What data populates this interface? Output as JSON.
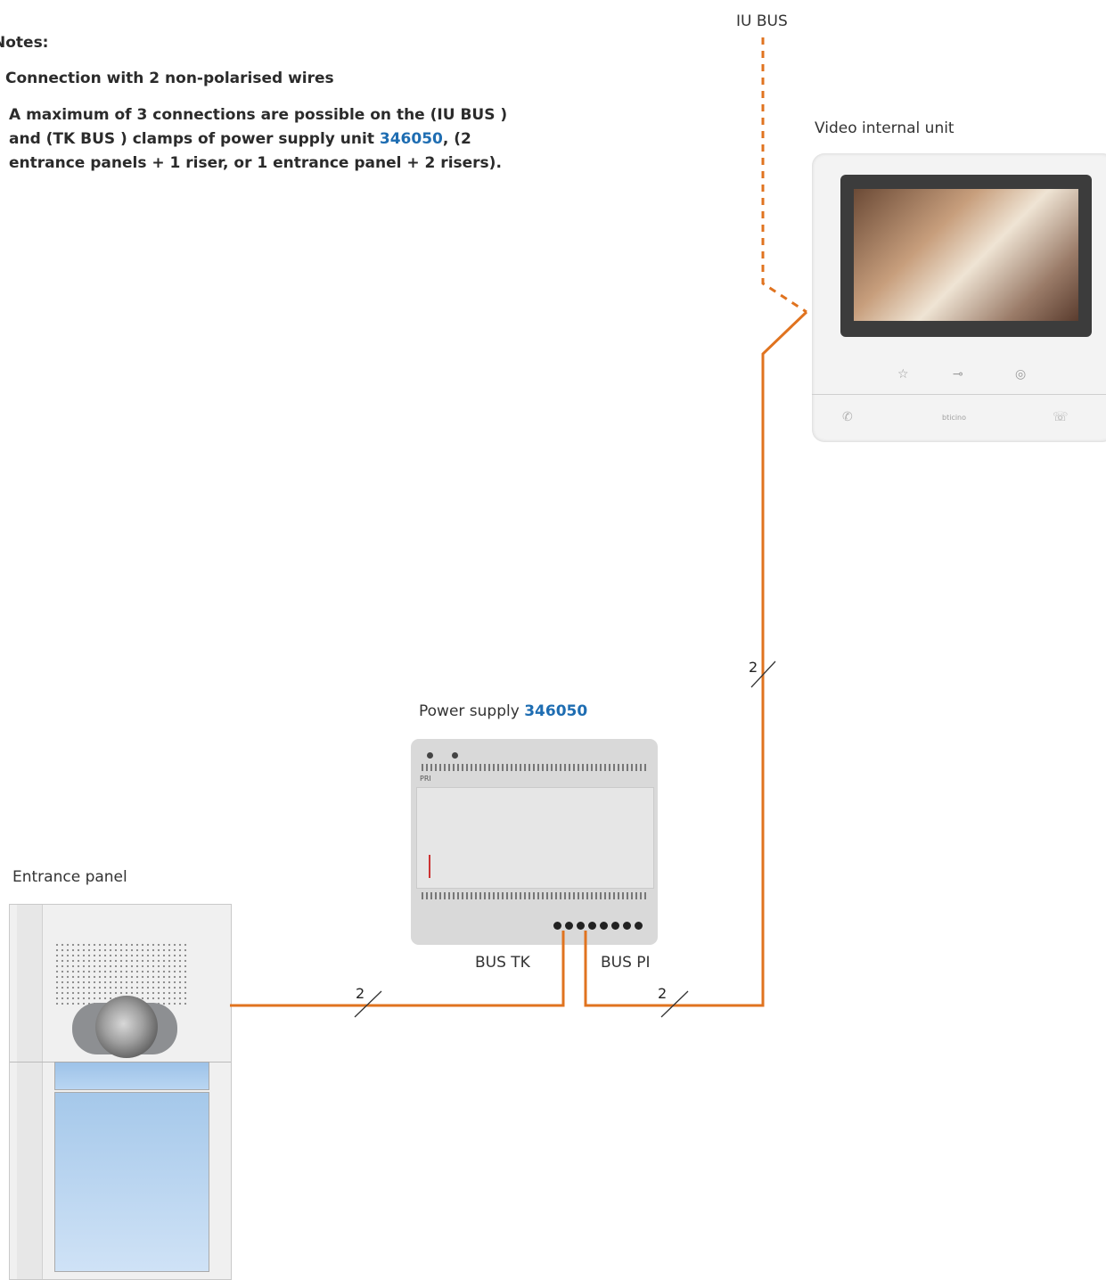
{
  "notes": {
    "title": "Notes:",
    "line1": "Connection with 2 non-polarised wires",
    "line2_a": "A maximum of 3 connections are possible on the (IU BUS ) and (TK BUS ) clamps of power supply unit ",
    "line2_code": "346050",
    "line2_b": ", (2 entrance panels + 1 riser, or 1 entrance panel + 2 risers)."
  },
  "labels": {
    "iu_bus": "IU BUS",
    "video_internal_unit": "Video internal unit",
    "power_supply": "Power supply ",
    "power_supply_code": "346050",
    "entrance_panel": "Entrance panel",
    "bus_tk": "BUS TK",
    "bus_pi": "BUS PI"
  },
  "wire_counts": {
    "riser": "2",
    "entrance": "2",
    "pi": "2"
  },
  "device_text": {
    "brand": "bticino",
    "pri": "PRI"
  },
  "colors": {
    "wire": "#e0731f",
    "code": "#1e6db2"
  },
  "icons": {
    "favorite": "star-icon",
    "door": "key-icon",
    "eye": "eye-icon",
    "answer": "handset-icon",
    "hangup": "hangup-icon"
  }
}
